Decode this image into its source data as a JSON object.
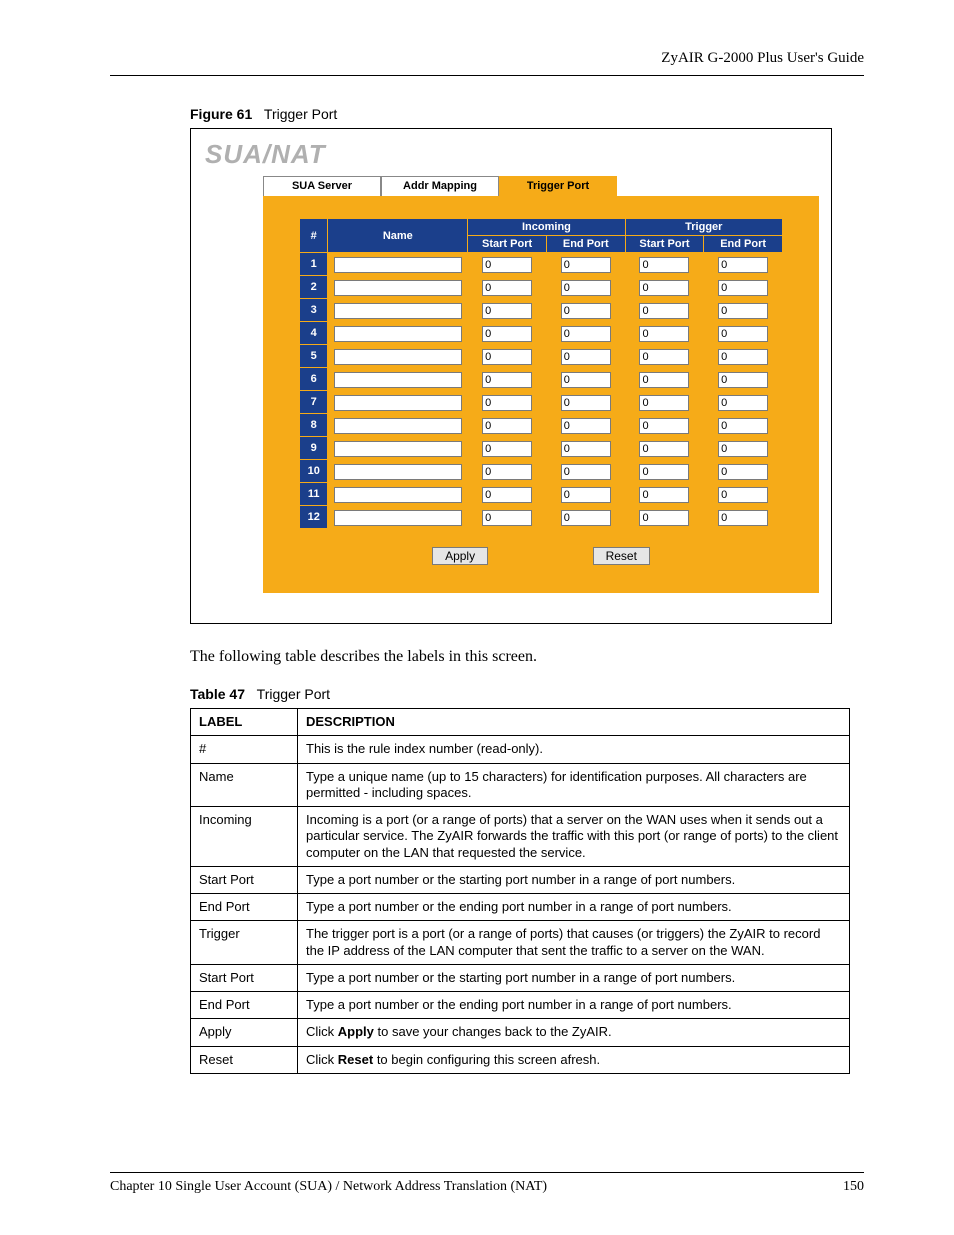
{
  "header": {
    "doc_title": "ZyAIR G-2000 Plus User's Guide"
  },
  "figure": {
    "label": "Figure 61",
    "title": "Trigger Port"
  },
  "screenshot": {
    "page_title": "SUA/NAT",
    "tabs": [
      {
        "label": "SUA Server",
        "active": false
      },
      {
        "label": "Addr Mapping",
        "active": false
      },
      {
        "label": "Trigger Port",
        "active": true
      }
    ],
    "columns": {
      "idx": "#",
      "name": "Name",
      "incoming": "Incoming",
      "trigger": "Trigger",
      "start_port": "Start Port",
      "end_port": "End Port"
    },
    "rows": [
      {
        "idx": "1",
        "name": "",
        "in_start": "0",
        "in_end": "0",
        "tr_start": "0",
        "tr_end": "0"
      },
      {
        "idx": "2",
        "name": "",
        "in_start": "0",
        "in_end": "0",
        "tr_start": "0",
        "tr_end": "0"
      },
      {
        "idx": "3",
        "name": "",
        "in_start": "0",
        "in_end": "0",
        "tr_start": "0",
        "tr_end": "0"
      },
      {
        "idx": "4",
        "name": "",
        "in_start": "0",
        "in_end": "0",
        "tr_start": "0",
        "tr_end": "0"
      },
      {
        "idx": "5",
        "name": "",
        "in_start": "0",
        "in_end": "0",
        "tr_start": "0",
        "tr_end": "0"
      },
      {
        "idx": "6",
        "name": "",
        "in_start": "0",
        "in_end": "0",
        "tr_start": "0",
        "tr_end": "0"
      },
      {
        "idx": "7",
        "name": "",
        "in_start": "0",
        "in_end": "0",
        "tr_start": "0",
        "tr_end": "0"
      },
      {
        "idx": "8",
        "name": "",
        "in_start": "0",
        "in_end": "0",
        "tr_start": "0",
        "tr_end": "0"
      },
      {
        "idx": "9",
        "name": "",
        "in_start": "0",
        "in_end": "0",
        "tr_start": "0",
        "tr_end": "0"
      },
      {
        "idx": "10",
        "name": "",
        "in_start": "0",
        "in_end": "0",
        "tr_start": "0",
        "tr_end": "0"
      },
      {
        "idx": "11",
        "name": "",
        "in_start": "0",
        "in_end": "0",
        "tr_start": "0",
        "tr_end": "0"
      },
      {
        "idx": "12",
        "name": "",
        "in_start": "0",
        "in_end": "0",
        "tr_start": "0",
        "tr_end": "0"
      }
    ],
    "apply_label": "Apply",
    "reset_label": "Reset"
  },
  "intro_text": "The following table describes the labels in this screen.",
  "table_caption": {
    "label": "Table 47",
    "title": "Trigger Port"
  },
  "desc_table": {
    "hdr_label": "LABEL",
    "hdr_desc": "DESCRIPTION",
    "rows": [
      {
        "label": "#",
        "desc_html": "This is the rule index number (read-only)."
      },
      {
        "label": "Name",
        "desc_html": "Type a unique name (up to 15 characters) for identification purposes. All characters are permitted - including spaces."
      },
      {
        "label": "Incoming",
        "desc_html": "Incoming is a port (or a range of ports) that a server on the WAN uses when it sends out a particular service. The ZyAIR forwards the traffic with this port (or range of ports) to the client computer on the LAN that requested the service."
      },
      {
        "label": "Start Port",
        "desc_html": "Type a port number or the starting port number in a range of port numbers."
      },
      {
        "label": "End Port",
        "desc_html": "Type a port number or the ending port number in a range of port numbers."
      },
      {
        "label": "Trigger",
        "desc_html": "The trigger port is a port (or a range of ports) that causes (or triggers) the ZyAIR to record the IP address of the LAN computer that sent the traffic to a server on the WAN."
      },
      {
        "label": "Start Port",
        "desc_html": "Type a port number or the starting port number in a range of port numbers."
      },
      {
        "label": "End Port",
        "desc_html": "Type a port number or the ending port number in a range of port numbers."
      },
      {
        "label": "Apply",
        "desc_html": "Click <b>Apply</b> to save your changes back to the ZyAIR."
      },
      {
        "label": "Reset",
        "desc_html": "Click <b>Reset</b> to begin configuring this screen afresh."
      }
    ]
  },
  "footer": {
    "chapter": "Chapter 10 Single User Account (SUA) / Network Address Translation (NAT)",
    "page": "150"
  }
}
